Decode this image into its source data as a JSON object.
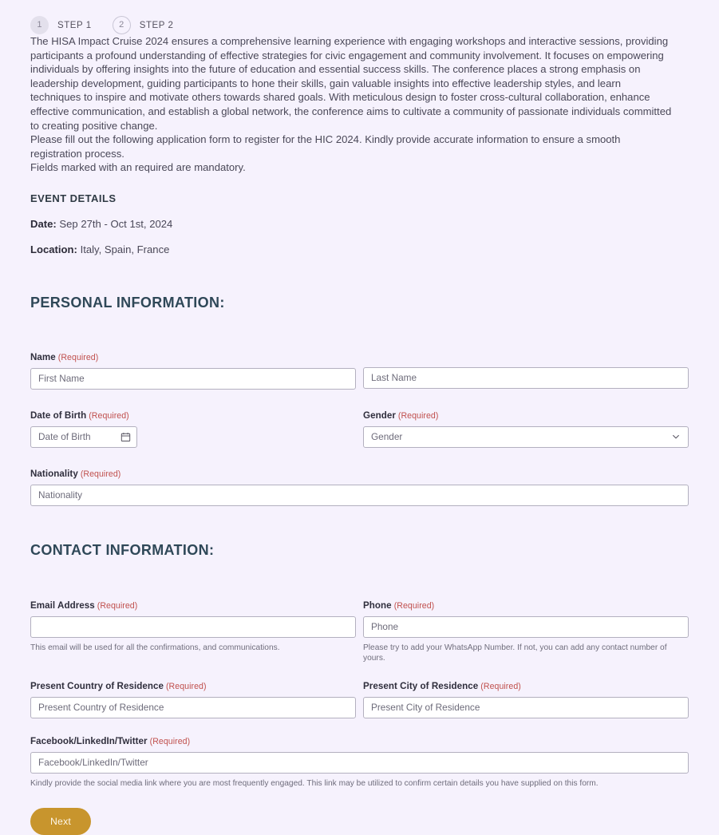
{
  "steps": [
    {
      "number": "1",
      "label": "STEP 1",
      "state": "active"
    },
    {
      "number": "2",
      "label": "STEP 2",
      "state": "inactive"
    }
  ],
  "intro": {
    "paragraph": "The HISA Impact Cruise 2024 ensures a comprehensive learning experience with engaging workshops and interactive sessions, providing participants a profound understanding of effective strategies for civic engagement and community involvement. It focuses on empowering individuals by offering insights into the future of education and essential success skills. The conference places a strong emphasis on leadership development, guiding participants to hone their skills, gain valuable insights into effective leadership styles, and learn techniques to inspire and motivate others towards shared goals. With meticulous design to foster cross-cultural collaboration, enhance effective communication, and establish a global network, the conference aims to cultivate a community of passionate individuals committed to creating positive change.",
    "instructions": "Please fill out the following application form to register for the HIC 2024. Kindly provide accurate information to ensure a smooth registration process.",
    "mandatory_note": "Fields marked with an required are mandatory."
  },
  "event_details": {
    "heading": "EVENT DETAILS",
    "date_label": "Date:",
    "date_value": "Sep 27th - Oct 1st, 2024",
    "location_label": "Location:",
    "location_value": "Italy, Spain, France"
  },
  "sections": {
    "personal": "PERSONAL INFORMATION:",
    "contact": "CONTACT INFORMATION:"
  },
  "required_tag": "(Required)",
  "fields": {
    "name": {
      "label": "Name",
      "first_placeholder": "First Name",
      "last_placeholder": "Last Name"
    },
    "dob": {
      "label": "Date of Birth",
      "placeholder": "Date of Birth"
    },
    "gender": {
      "label": "Gender",
      "placeholder": "Gender"
    },
    "nationality": {
      "label": "Nationality",
      "placeholder": "Nationality"
    },
    "email": {
      "label": "Email Address",
      "placeholder": "",
      "value": "",
      "helper": "This email will be used for all the confirmations, and communications."
    },
    "phone": {
      "label": "Phone",
      "placeholder": "Phone",
      "helper": "Please try to add your WhatsApp Number. If not, you can add any contact number of yours."
    },
    "country": {
      "label": "Present Country of Residence",
      "placeholder": "Present Country of Residence"
    },
    "city": {
      "label": "Present City of Residence",
      "placeholder": "Present City of Residence"
    },
    "social": {
      "label": "Facebook/LinkedIn/Twitter",
      "placeholder": "Facebook/LinkedIn/Twitter",
      "helper": "Kindly provide the social media link where you are most frequently engaged. This link may be utilized to confirm certain details you have supplied on this form."
    }
  },
  "actions": {
    "next_label": "Next"
  },
  "colors": {
    "background": "#f6f2fd",
    "accent_button": "#c8952d",
    "required_red": "#c0504d",
    "heading": "#2f4858",
    "input_border": "#b3b0bf"
  },
  "icons": {
    "calendar": "calendar-icon",
    "chevron_down": "chevron-down-icon"
  }
}
